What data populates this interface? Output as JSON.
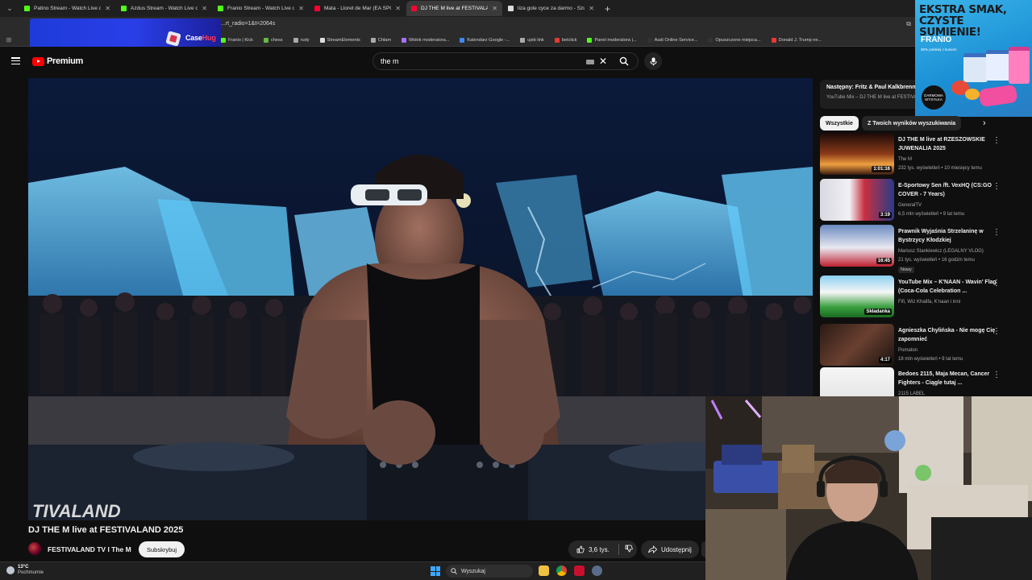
{
  "browser": {
    "tabs": [
      {
        "title": "Patino Stream - Watch Live on Kick",
        "color": "#53fc18",
        "active": false
      },
      {
        "title": "Azdus Stream - Watch Live on Kick",
        "color": "#53fc18",
        "active": false
      },
      {
        "title": "Franio Stream - Watch Live on Kick",
        "color": "#53fc18",
        "active": false
      },
      {
        "title": "Mata - Lloret de Mar (EA SPORTS",
        "color": "#ff0033",
        "active": false
      },
      {
        "title": "DJ THE M live at FESTIVALAND",
        "color": "#ff0033",
        "active": true
      },
      {
        "title": "liza gole cyce za darmo - Szukaj",
        "color": "#dddddd",
        "active": false
      }
    ],
    "address": "...rt_radio=1&t=2064s",
    "bookmarks": [
      {
        "label": "chess",
        "color": "#66bb44"
      },
      {
        "label": "rudy",
        "color": "#aaaaaa"
      },
      {
        "label": "StreamElements",
        "color": "#dddddd"
      },
      {
        "label": "Chłam",
        "color": "#aaaaaa"
      },
      {
        "label": "Widok moderatora...",
        "color": "#a970ff"
      },
      {
        "label": "Kalendarz Google -...",
        "color": "#4285f4"
      },
      {
        "label": "ujeb link",
        "color": "#aaaaaa"
      },
      {
        "label": "betclick",
        "color": "#e53935"
      },
      {
        "label": "Panel moderatora |...",
        "color": "#53fc18"
      },
      {
        "label": "Audi Online Service...",
        "color": "#333333"
      },
      {
        "label": "Opuszczone miejsca...",
        "color": "#333333"
      },
      {
        "label": "Donald J. Trump ne...",
        "color": "#e53935"
      }
    ],
    "bookmark_partial": "Franio | Kick"
  },
  "overlay": {
    "brand_a": "Case",
    "brand_b": "Hug"
  },
  "youtube": {
    "logo_text": "Premium",
    "search_query": "the m",
    "video_title": "DJ THE M live at FESTIVALAND 2025",
    "channel_name": "FESTIVALAND TV I The M",
    "subscribe_label": "Subskrybuj",
    "likes": "3,6 tys.",
    "share_label": "Udostępnij",
    "up_next": {
      "title": "Następny: Fritz & Paul Kalkbrenner",
      "subtitle": "YouTube Mix – DJ THE M live at FESTIVALAND"
    },
    "chips": [
      "Wszystkie",
      "Z Twoich wyników wyszukiwania"
    ],
    "recommendations": [
      {
        "title": "DJ THE M live at RZESZOWSKIE JUWENALIA 2025",
        "channel": "The M",
        "meta": "232 tys. wyświetleń • 10 miesięcy temu",
        "duration": "1:01:16",
        "badge": ""
      },
      {
        "title": "E-Sportowy Sen /ft. VexHQ (CS:GO COVER - 7 Years)",
        "channel": "GeneralTV",
        "meta": "6,5 mln wyświetleń • 9 lat temu",
        "duration": "3:19",
        "badge": ""
      },
      {
        "title": "Prawnik Wyjaśnia Strzelaninę w Bystrzycy Kłodzkiej",
        "channel": "Mariusz Stankiewicz (LEGALNY VLOG)",
        "meta": "21 tys. wyświetleń • 16 godzin temu",
        "duration": "16:45",
        "badge": "Nowy"
      },
      {
        "title": "YouTube Mix – K'NAAN - Wavin' Flag (Coca-Cola Celebration ...",
        "channel": "",
        "meta": "Fifi, Wiz Khalifa, K'naan i inni",
        "duration": "Składanka",
        "badge": ""
      },
      {
        "title": "Agnieszka Chylińska - Nie mogę Cię zapomnieć",
        "channel": "Pomaton",
        "meta": "18 mln wyświetleń • 9 lat temu",
        "duration": "4:17",
        "badge": ""
      },
      {
        "title": "Bedoes 2115, Maja Mecan, Cancer Fighters - Ciągle tutaj ...",
        "channel": "2115 LABEL",
        "meta": "",
        "duration": "",
        "badge": ""
      }
    ]
  },
  "ad": {
    "headline": "EKSTRA SMAK, CZYSTE SUMIENIE!",
    "brand": "FRANIO",
    "small_print": "30% polskiej z koniem",
    "badge": "DARMOWA WYSYŁKA"
  },
  "taskbar": {
    "temp": "13°C",
    "condition": "Pochmurnie",
    "search_label": "Wyszukaj"
  },
  "colors": {
    "youtube_red": "#ff0000",
    "kick_green": "#53fc18",
    "windows_blue": "#3fa7ff"
  }
}
